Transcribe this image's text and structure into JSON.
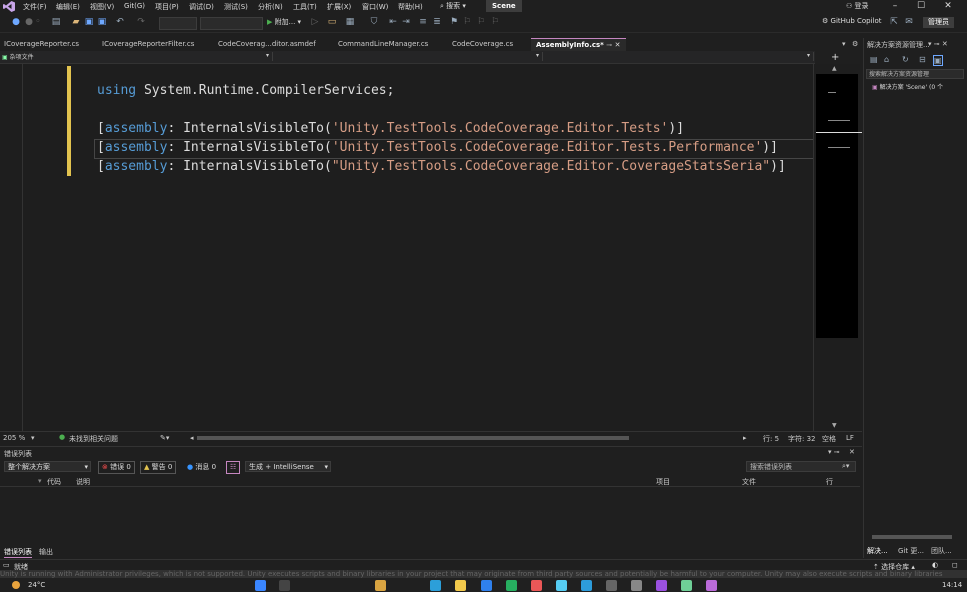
{
  "menubar": {
    "items": [
      "文件(F)",
      "编辑(E)",
      "视图(V)",
      "Git(G)",
      "项目(P)",
      "调试(D)",
      "测试(S)",
      "分析(N)",
      "工具(T)",
      "扩展(X)",
      "窗口(W)",
      "帮助(H)"
    ],
    "search_label": "搜索",
    "solution_badge": "Scene",
    "login_label": "登录"
  },
  "toolbar": {
    "attach_label": "附加...",
    "copilot_label": "GitHub Copilot",
    "admin_label": "管理员"
  },
  "tabs": [
    {
      "label": "ICoverageReporter.cs",
      "active": false
    },
    {
      "label": "ICoverageReporterFilter.cs",
      "active": false
    },
    {
      "label": "CodeCoverag...ditor.asmdef",
      "active": false
    },
    {
      "label": "CommandLineManager.cs",
      "active": false
    },
    {
      "label": "CodeCoverage.cs",
      "active": false
    },
    {
      "label": "AssemblyInfo.cs*",
      "active": true
    }
  ],
  "navbar": {
    "project_label": "杂项文件"
  },
  "code": {
    "line1_kw": "using",
    "line1_rest": " System.Runtime.CompilerServices;",
    "lines": [
      {
        "pre": "[",
        "kw": "assembly",
        "mid": ": InternalsVisibleTo(",
        "str": "'Unity.TestTools.CodeCoverage.Editor.Tests'",
        "post": ")]"
      },
      {
        "pre": "[",
        "kw": "assembly",
        "mid": ": InternalsVisibleTo(",
        "str": "'Unity.TestTools.CodeCoverage.Editor.Tests.Performance'",
        "post": ")]"
      },
      {
        "pre": "[",
        "kw": "assembly",
        "mid": ": InternalsVisibleTo(",
        "str": "\"Unity.TestTools.CodeCoverage.Editor.CoverageStatsSeria\"",
        "post": ")]"
      }
    ]
  },
  "editor_status": {
    "zoom": "205 %",
    "issues": "未找到相关问题",
    "line": "行: 5",
    "col": "字符: 32",
    "whitespace": "空格",
    "eol": "LF"
  },
  "error_list": {
    "title": "错误列表",
    "scope": "整个解决方案",
    "errors": "错误 0",
    "warnings": "警告 0",
    "messages": "消息 0",
    "build_filter": "生成 + IntelliSense",
    "search_placeholder": "搜索错误列表",
    "columns": [
      "代码",
      "说明",
      "项目",
      "文件",
      "行"
    ],
    "tab_error": "错误列表",
    "tab_output": "输出"
  },
  "solution_explorer": {
    "title": "解决方案资源管理...",
    "search_placeholder": "搜索解决方案资源管理",
    "item": "解决方案 'Scene' (0 个",
    "tab1": "解决...",
    "tab2": "Git 更...",
    "tab3": "团队..."
  },
  "vs_status": {
    "ready": "就绪",
    "repo": "选择仓库"
  },
  "warning_strip": "Unity is running with Administrator privileges, which is not supported. Unity executes scripts and binary libraries in your project that may originate from third party sources and potentially be harmful to your computer. Unity may also execute scripts and binary libraries",
  "taskbar": {
    "weather": "24°C",
    "time": "14:14"
  }
}
